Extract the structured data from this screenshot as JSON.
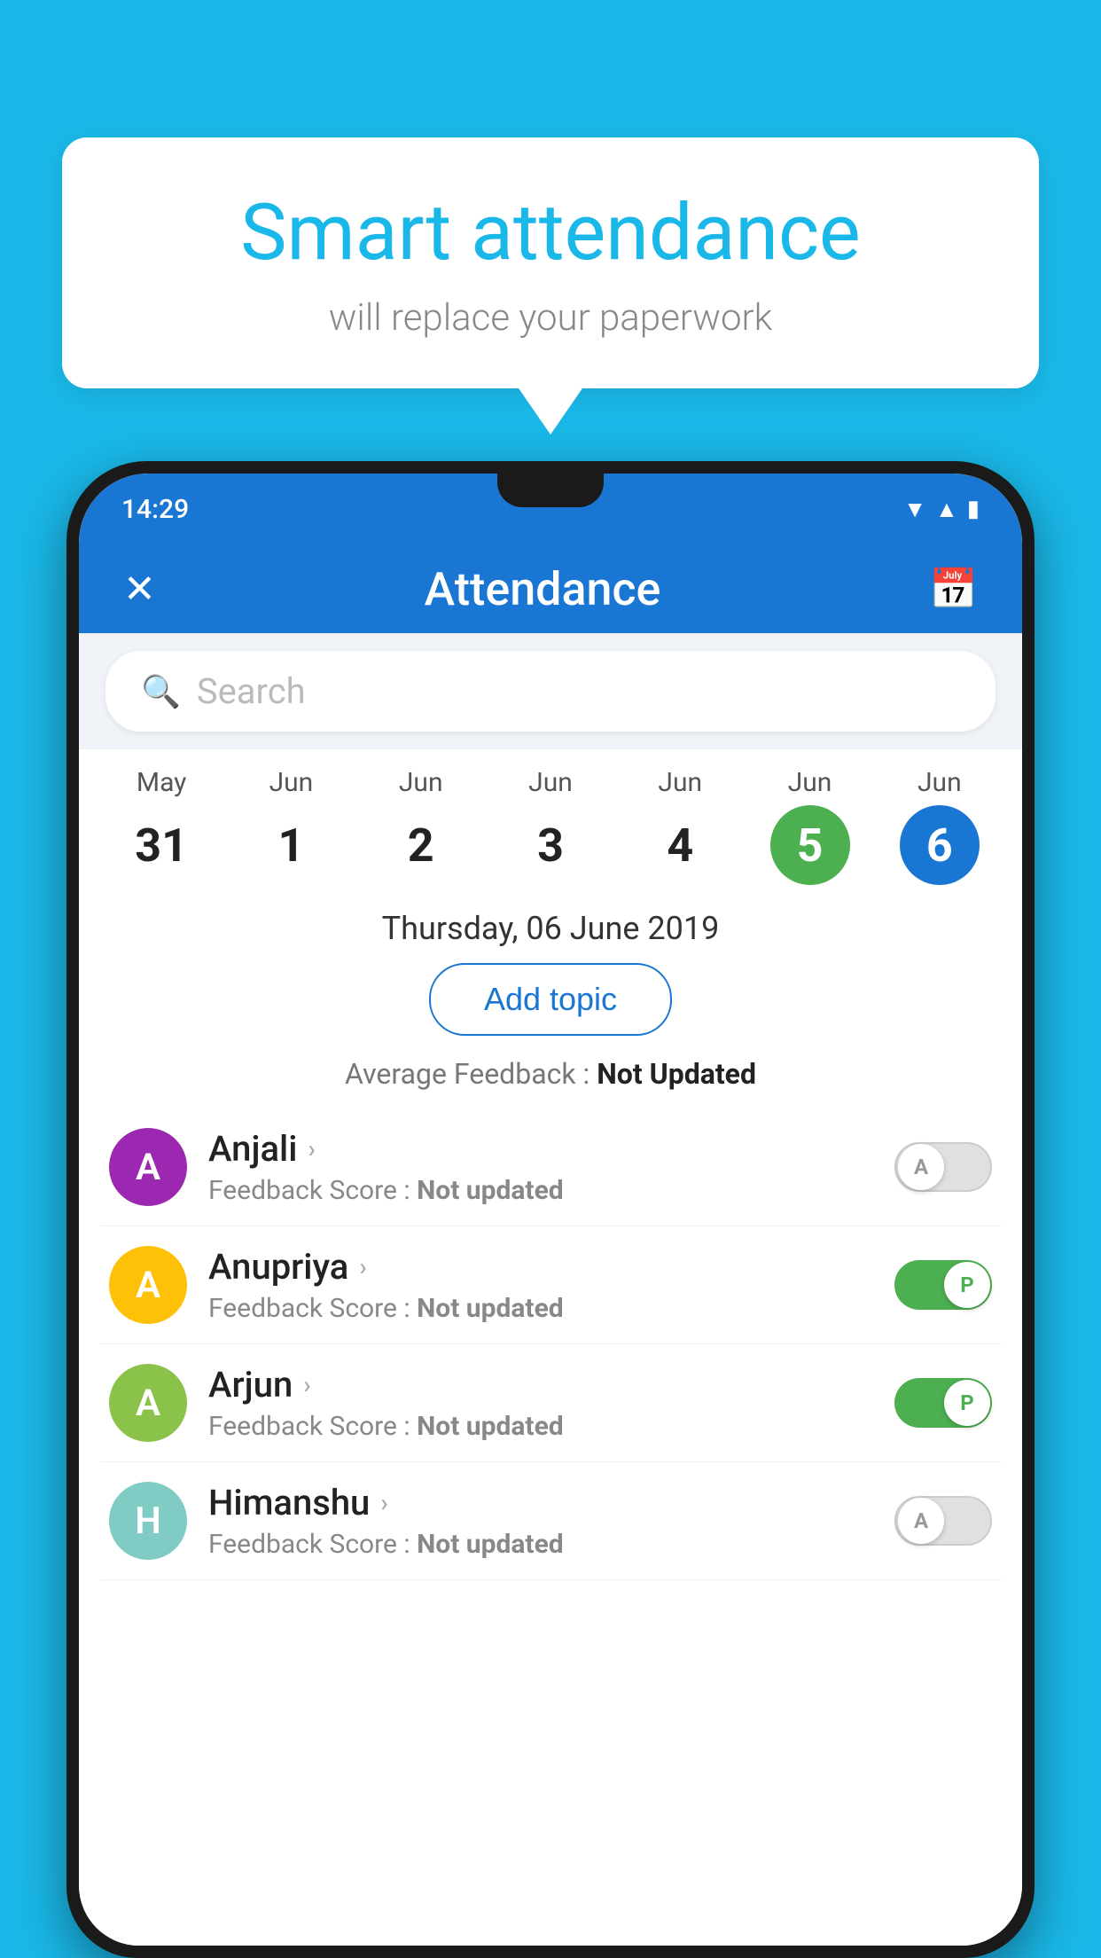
{
  "background_color": "#1ab8e8",
  "bubble": {
    "title": "Smart attendance",
    "subtitle": "will replace your paperwork"
  },
  "phone": {
    "status_bar": {
      "time": "14:29"
    },
    "app_bar": {
      "title": "Attendance",
      "close_label": "×",
      "calendar_icon": "calendar-icon"
    },
    "search": {
      "placeholder": "Search"
    },
    "calendar": {
      "days": [
        {
          "month": "May",
          "date": "31",
          "state": "normal"
        },
        {
          "month": "Jun",
          "date": "1",
          "state": "normal"
        },
        {
          "month": "Jun",
          "date": "2",
          "state": "normal"
        },
        {
          "month": "Jun",
          "date": "3",
          "state": "normal"
        },
        {
          "month": "Jun",
          "date": "4",
          "state": "normal"
        },
        {
          "month": "Jun",
          "date": "5",
          "state": "today"
        },
        {
          "month": "Jun",
          "date": "6",
          "state": "selected"
        }
      ]
    },
    "selected_date": "Thursday, 06 June 2019",
    "add_topic_label": "Add topic",
    "avg_feedback_label": "Average Feedback :",
    "avg_feedback_value": "Not Updated",
    "students": [
      {
        "name": "Anjali",
        "initial": "A",
        "avatar_color": "purple",
        "score_label": "Feedback Score :",
        "score_value": "Not updated",
        "toggle": "off",
        "toggle_letter": "A"
      },
      {
        "name": "Anupriya",
        "initial": "A",
        "avatar_color": "yellow",
        "score_label": "Feedback Score :",
        "score_value": "Not updated",
        "toggle": "on",
        "toggle_letter": "P"
      },
      {
        "name": "Arjun",
        "initial": "A",
        "avatar_color": "green",
        "score_label": "Feedback Score :",
        "score_value": "Not updated",
        "toggle": "on",
        "toggle_letter": "P"
      },
      {
        "name": "Himanshu",
        "initial": "H",
        "avatar_color": "teal",
        "score_label": "Feedback Score :",
        "score_value": "Not updated",
        "toggle": "off",
        "toggle_letter": "A"
      }
    ]
  }
}
